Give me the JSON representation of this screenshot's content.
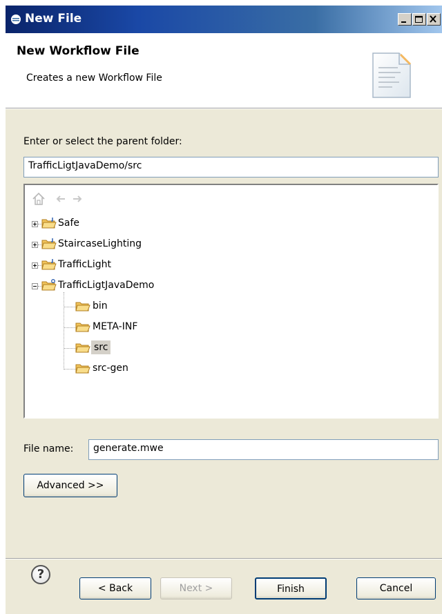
{
  "window": {
    "title": "New File"
  },
  "header": {
    "title": "New Workflow File",
    "description": "Creates a new Workflow File"
  },
  "folder": {
    "label": "Enter or select the parent folder:",
    "value": "TrafficLigtJavaDemo/src"
  },
  "tree": {
    "items": [
      {
        "label": "Safe"
      },
      {
        "label": "StaircaseLighting"
      },
      {
        "label": "TrafficLight"
      },
      {
        "label": "TrafficLigtJavaDemo"
      },
      {
        "label": "bin"
      },
      {
        "label": "META-INF"
      },
      {
        "label": "src"
      },
      {
        "label": "src-gen"
      }
    ]
  },
  "file": {
    "label": "File name:",
    "value": "generate.mwe"
  },
  "buttons": {
    "advanced": "Advanced >>",
    "back": "< Back",
    "next": "Next >",
    "finish": "Finish",
    "cancel": "Cancel",
    "help": "?"
  },
  "colors": {
    "title_bar_start": "#0a246a",
    "title_bar_end": "#a6caf0",
    "dialog_bg": "#ece9d8",
    "folder_yellow": "#f2c55c"
  }
}
